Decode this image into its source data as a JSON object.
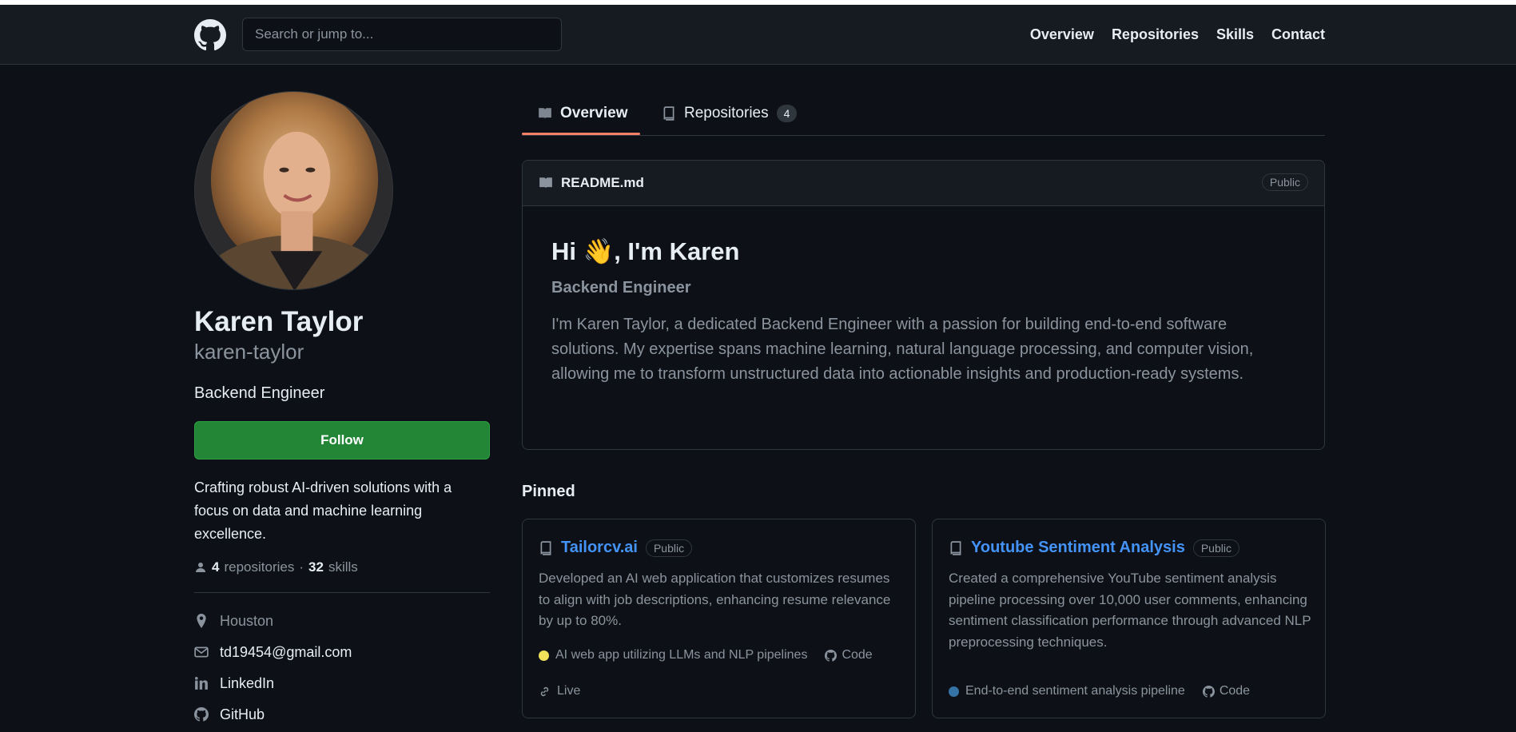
{
  "header": {
    "search_placeholder": "Search or jump to...",
    "nav": [
      "Overview",
      "Repositories",
      "Skills",
      "Contact"
    ]
  },
  "profile": {
    "name": "Karen Taylor",
    "login": "karen-taylor",
    "role": "Backend Engineer",
    "follow_label": "Follow",
    "bio": "Crafting robust AI-driven solutions with a focus on data and machine learning excellence.",
    "repos_count": "4",
    "repos_label": "repositories",
    "sep": "·",
    "skills_count": "32",
    "skills_label": "skills",
    "location": "Houston",
    "email": "td19454@gmail.com",
    "linkedin": "LinkedIn",
    "github": "GitHub"
  },
  "tabs": {
    "overview": "Overview",
    "repositories": "Repositories",
    "repositories_count": "4"
  },
  "readme": {
    "file": "README.md",
    "badge": "Public",
    "title": "Hi 👋, I'm Karen",
    "subtitle": "Backend Engineer",
    "body": "I'm Karen Taylor, a dedicated Backend Engineer with a passion for building end-to-end software solutions. My expertise spans machine learning, natural language processing, and computer vision, allowing me to transform unstructured data into actionable insights and production-ready systems."
  },
  "pinned": {
    "title": "Pinned",
    "cards": [
      {
        "title": "Tailorcv.ai",
        "badge": "Public",
        "desc": "Developed an AI web application that customizes resumes to align with job descriptions, enhancing resume relevance by up to 80%.",
        "lang": "AI web app utilizing LLMs and NLP pipelines",
        "lang_color": "#f1e05a",
        "code": "Code",
        "live": "Live"
      },
      {
        "title": "Youtube Sentiment Analysis",
        "badge": "Public",
        "desc": "Created a comprehensive YouTube sentiment analysis pipeline processing over 10,000 user comments, enhancing sentiment classification performance through advanced NLP preprocessing techniques.",
        "lang": "End-to-end sentiment analysis pipeline",
        "lang_color": "#3572a5",
        "code": "Code"
      }
    ]
  }
}
